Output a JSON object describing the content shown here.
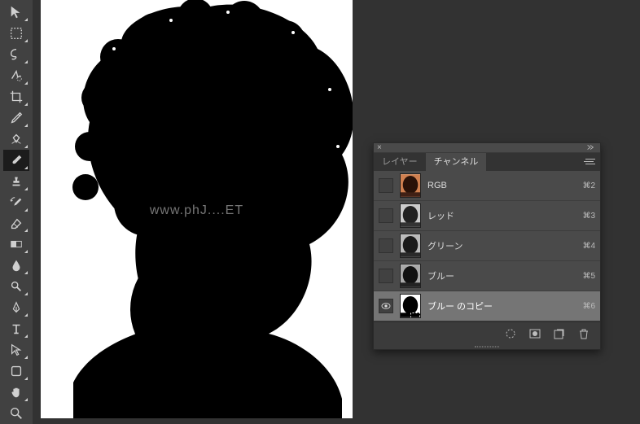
{
  "watermark": "www.phJ....ET",
  "panel": {
    "tabs": [
      {
        "label": "レイヤー",
        "active": false
      },
      {
        "label": "チャンネル",
        "active": true
      }
    ],
    "channels": [
      {
        "name": "RGB",
        "shortcut": "⌘2",
        "visible": false,
        "selected": false,
        "thumb": "color"
      },
      {
        "name": "レッド",
        "shortcut": "⌘3",
        "visible": false,
        "selected": false,
        "thumb": "gray"
      },
      {
        "name": "グリーン",
        "shortcut": "⌘4",
        "visible": false,
        "selected": false,
        "thumb": "gray"
      },
      {
        "name": "ブルー",
        "shortcut": "⌘5",
        "visible": false,
        "selected": false,
        "thumb": "gray"
      },
      {
        "name": "ブルー のコピー",
        "shortcut": "⌘6",
        "visible": true,
        "selected": true,
        "thumb": "bw"
      }
    ],
    "footer_icons": [
      "selection-dotted-icon",
      "mask-icon",
      "new-channel-icon",
      "trash-icon"
    ]
  },
  "tools": [
    "move-tool",
    "marquee-tool",
    "lasso-tool",
    "quick-select-tool",
    "crop-tool",
    "eyedropper-tool",
    "patch-tool",
    "brush-tool",
    "stamp-tool",
    "history-brush-tool",
    "eraser-tool",
    "gradient-tool",
    "blur-tool",
    "dodge-tool",
    "pen-tool",
    "type-tool",
    "path-select-tool",
    "shape-tool",
    "hand-tool",
    "zoom-tool"
  ],
  "active_tool": "brush-tool"
}
